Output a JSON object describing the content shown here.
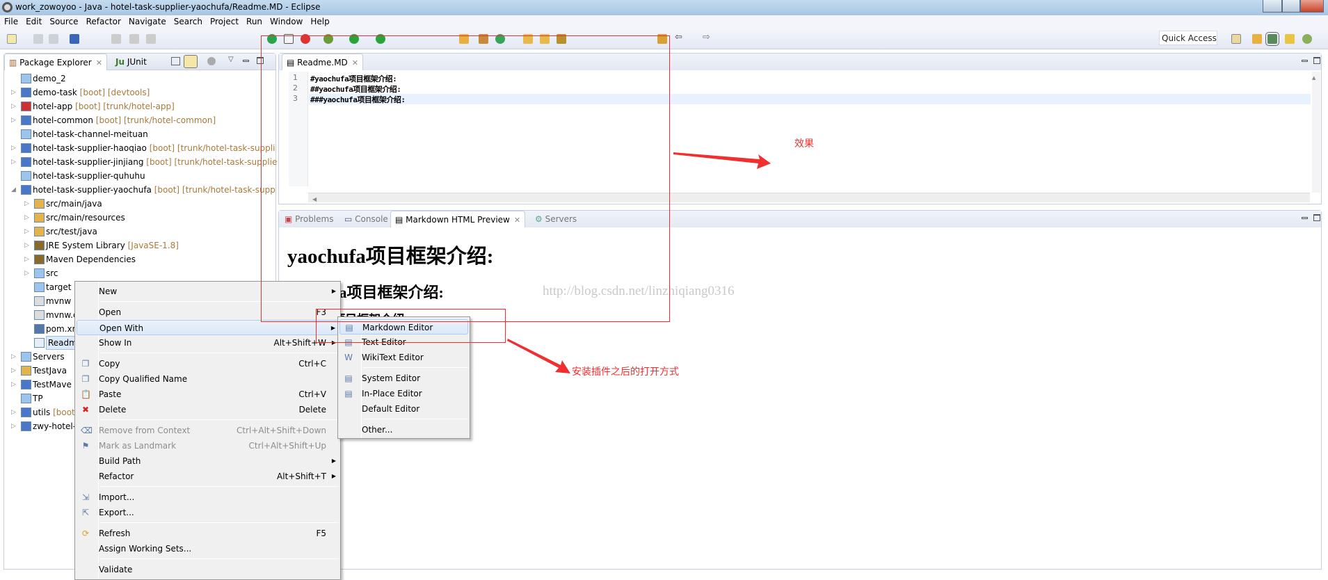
{
  "window": {
    "title": "work_zowoyoo - Java - hotel-task-supplier-yaochufa/Readme.MD - Eclipse"
  },
  "menubar": [
    "File",
    "Edit",
    "Source",
    "Refactor",
    "Navigate",
    "Search",
    "Project",
    "Run",
    "Window",
    "Help"
  ],
  "toolbar": {
    "quick_access": "Quick Access"
  },
  "left_panel": {
    "tabs": [
      {
        "label": "Package Explorer",
        "active": true
      },
      {
        "label": "JUnit",
        "icon_text": "Ju",
        "active": false
      }
    ],
    "tree": [
      {
        "level": 0,
        "label": "demo_2",
        "decoration": "",
        "expandable": false,
        "icon": "folder-icon"
      },
      {
        "level": 0,
        "label": "demo-task",
        "decoration": "[boot] [devtools]",
        "expandable": true,
        "icon": "maven-project-icon"
      },
      {
        "level": 0,
        "label": "hotel-app",
        "decoration": "[boot] [trunk/hotel-app]",
        "expandable": true,
        "icon": "maven-project-error-icon"
      },
      {
        "level": 0,
        "label": "hotel-common",
        "decoration": "[boot] [trunk/hotel-common]",
        "expandable": true,
        "icon": "maven-project-icon"
      },
      {
        "level": 0,
        "label": "hotel-task-channel-meituan",
        "decoration": "",
        "expandable": false,
        "icon": "folder-icon"
      },
      {
        "level": 0,
        "label": "hotel-task-supplier-haoqiao",
        "decoration": "[boot] [trunk/hotel-task-suppli",
        "expandable": true,
        "icon": "maven-project-icon"
      },
      {
        "level": 0,
        "label": "hotel-task-supplier-jinjiang",
        "decoration": "[boot] [trunk/hotel-task-supplie",
        "expandable": true,
        "icon": "maven-project-icon"
      },
      {
        "level": 0,
        "label": "hotel-task-supplier-quhuhu",
        "decoration": "",
        "expandable": false,
        "icon": "folder-icon"
      },
      {
        "level": 0,
        "label": "hotel-task-supplier-yaochufa",
        "decoration": "[boot] [trunk/hotel-task-supp",
        "expandable": true,
        "expanded": true,
        "icon": "maven-project-icon"
      },
      {
        "level": 1,
        "label": "src/main/java",
        "decoration": "",
        "expandable": true,
        "icon": "source-folder-icon"
      },
      {
        "level": 1,
        "label": "src/main/resources",
        "decoration": "",
        "expandable": true,
        "icon": "source-folder-icon"
      },
      {
        "level": 1,
        "label": "src/test/java",
        "decoration": "",
        "expandable": true,
        "icon": "source-folder-icon"
      },
      {
        "level": 1,
        "label": "JRE System Library",
        "decoration": "[JavaSE-1.8]",
        "expandable": true,
        "icon": "library-icon"
      },
      {
        "level": 1,
        "label": "Maven Dependencies",
        "decoration": "",
        "expandable": true,
        "icon": "library-icon"
      },
      {
        "level": 1,
        "label": "src",
        "decoration": "",
        "expandable": true,
        "icon": "folder-icon"
      },
      {
        "level": 1,
        "label": "target",
        "decoration": "",
        "expandable": false,
        "icon": "folder-icon"
      },
      {
        "level": 1,
        "label": "mvnw",
        "decoration": "",
        "expandable": false,
        "icon": "file-icon"
      },
      {
        "level": 1,
        "label": "mvnw.c",
        "decoration": "",
        "expandable": false,
        "icon": "file-icon"
      },
      {
        "level": 1,
        "label": "pom.xr",
        "decoration": "",
        "expandable": false,
        "icon": "maven-file-icon"
      },
      {
        "level": 1,
        "label": "Readm",
        "decoration": "",
        "expandable": false,
        "selected": true,
        "icon": "markdown-file-icon"
      },
      {
        "level": 0,
        "label": "Servers",
        "decoration": "",
        "expandable": true,
        "icon": "folder-icon"
      },
      {
        "level": 0,
        "label": "TestJava",
        "decoration": "",
        "expandable": true,
        "icon": "java-project-icon"
      },
      {
        "level": 0,
        "label": "TestMave",
        "decoration": "",
        "expandable": true,
        "icon": "maven-project-icon"
      },
      {
        "level": 0,
        "label": "TP",
        "decoration": "",
        "expandable": false,
        "icon": "folder-icon"
      },
      {
        "level": 0,
        "label": "utils",
        "decoration": "[boot",
        "expandable": true,
        "icon": "maven-project-icon"
      },
      {
        "level": 0,
        "label": "zwy-hotel-",
        "decoration": "",
        "expandable": true,
        "icon": "maven-project-icon"
      }
    ]
  },
  "editor": {
    "tab": "Readme.MD",
    "lines": [
      {
        "n": "1",
        "text": "#yaochufa项目框架介绍:"
      },
      {
        "n": "2",
        "text": "##yaochufa项目框架介绍:"
      },
      {
        "n": "3",
        "text": "###yaochufa项目框架介绍:"
      }
    ]
  },
  "bottom_panel": {
    "tabs": [
      {
        "label": "Problems",
        "active": false
      },
      {
        "label": "Console",
        "active": false
      },
      {
        "label": "Markdown HTML Preview",
        "active": true
      },
      {
        "label": "Servers",
        "active": false
      }
    ],
    "preview": {
      "h1": "yaochufa项目框架介绍:",
      "h2": "yaochufa项目框架介绍:",
      "h3": "yaochufa项目框架介绍:"
    },
    "watermark": "http://blog.csdn.net/linzhiqiang0316"
  },
  "context_menu": [
    {
      "label": "New",
      "arrow": true
    },
    {
      "sep": true
    },
    {
      "label": "Open",
      "shortcut": "F3"
    },
    {
      "label": "Open With",
      "arrow": true,
      "hover": true
    },
    {
      "label": "Show In",
      "shortcut": "Alt+Shift+W",
      "arrow": true
    },
    {
      "sep": true
    },
    {
      "label": "Copy",
      "shortcut": "Ctrl+C",
      "icon": "copy-icon"
    },
    {
      "label": "Copy Qualified Name",
      "icon": "copy-qualified-icon"
    },
    {
      "label": "Paste",
      "shortcut": "Ctrl+V",
      "icon": "paste-icon"
    },
    {
      "label": "Delete",
      "shortcut": "Delete",
      "icon": "delete-icon"
    },
    {
      "sep": true
    },
    {
      "label": "Remove from Context",
      "shortcut": "Ctrl+Alt+Shift+Down",
      "disabled": true,
      "icon": "remove-context-icon"
    },
    {
      "label": "Mark as Landmark",
      "shortcut": "Ctrl+Alt+Shift+Up",
      "disabled": true,
      "icon": "landmark-icon"
    },
    {
      "label": "Build Path",
      "arrow": true
    },
    {
      "label": "Refactor",
      "shortcut": "Alt+Shift+T",
      "arrow": true
    },
    {
      "sep": true
    },
    {
      "label": "Import...",
      "icon": "import-icon"
    },
    {
      "label": "Export...",
      "icon": "export-icon"
    },
    {
      "sep": true
    },
    {
      "label": "Refresh",
      "shortcut": "F5",
      "icon": "refresh-icon"
    },
    {
      "label": "Assign Working Sets..."
    },
    {
      "sep": true
    },
    {
      "label": "Validate"
    }
  ],
  "open_with_submenu": [
    {
      "label": "Markdown Editor",
      "hover": true,
      "icon": "markdown-editor-icon"
    },
    {
      "label": "Text Editor",
      "icon": "text-editor-icon"
    },
    {
      "label": "WikiText Editor",
      "icon": "wikitext-editor-icon"
    },
    {
      "sep": true
    },
    {
      "label": "System Editor",
      "icon": "system-editor-icon"
    },
    {
      "label": "In-Place Editor",
      "icon": "inplace-editor-icon"
    },
    {
      "label": "Default Editor"
    },
    {
      "sep": true
    },
    {
      "label": "Other..."
    }
  ],
  "annotations": {
    "effect": "效果",
    "open_method": "安装插件之后的打开方式",
    "color": "#f03030"
  }
}
